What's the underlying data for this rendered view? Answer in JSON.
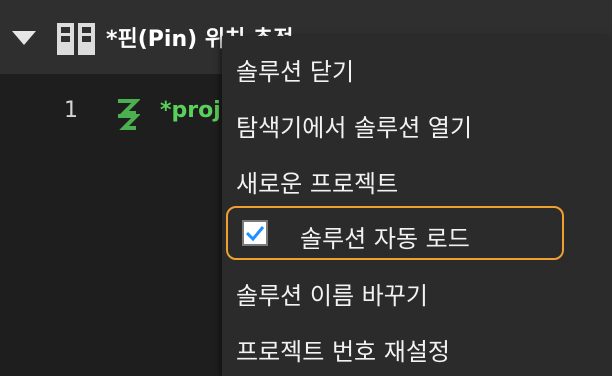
{
  "header": {
    "title": "*핀(Pin) 위치 추적"
  },
  "editor": {
    "line_number": "1",
    "project_name": "*proj"
  },
  "context_menu": {
    "items": [
      {
        "label": "솔루션 닫기"
      },
      {
        "label": "탐색기에서 솔루션 열기"
      },
      {
        "label": "새로운 프로젝트"
      },
      {
        "label": "솔루션 자동 로드",
        "checked": true
      },
      {
        "label": "솔루션 이름 바꾸기"
      },
      {
        "label": "프로젝트 번호 재설정"
      }
    ]
  },
  "colors": {
    "background": "#1e1e1e",
    "header": "#2f2f2f",
    "menu": "#2b2b2b",
    "highlight_border": "#f0a030",
    "check_accent": "#1e90ff",
    "project_text": "#5ad15a"
  },
  "icons": {
    "collapse": "triangle-down-icon",
    "solution": "solution-icon",
    "project": "project-icon",
    "check": "checkmark-icon"
  }
}
